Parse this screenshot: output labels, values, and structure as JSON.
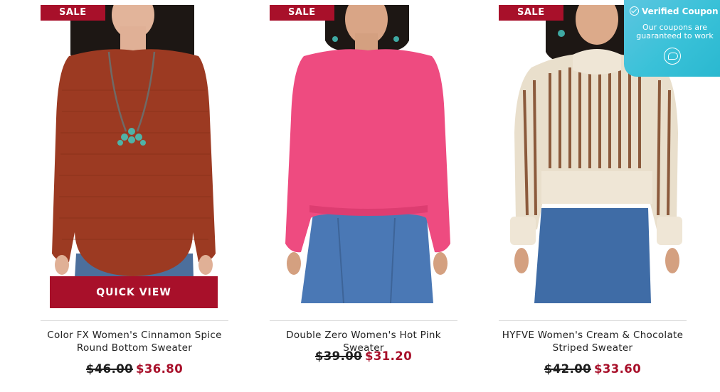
{
  "products": [
    {
      "badge": "SALE",
      "name": "Color FX Women's Cinnamon Spice Round Bottom Sweater",
      "old_price": "$46.00",
      "new_price": "$36.80",
      "quick_view": "QUICK VIEW",
      "sweater_color": "#9c3a22"
    },
    {
      "badge": "SALE",
      "name": "Double Zero Women's Hot Pink Sweater",
      "old_price": "$39.00",
      "new_price": "$31.20",
      "sweater_color": "#ee4b80"
    },
    {
      "badge": "SALE",
      "name": "HYFVE Women's Cream & Chocolate Striped Sweater",
      "old_price": "$42.00",
      "new_price": "$33.60",
      "sweater_color": "#e9dfcc"
    }
  ],
  "coupon": {
    "title": "Verified Coupon",
    "subtitle": "Our coupons are guaranteed to work",
    "icon": "chat-bubble-icon"
  },
  "colors": {
    "sale_red": "#a8102a",
    "coupon_blue": "#39c1d8"
  }
}
